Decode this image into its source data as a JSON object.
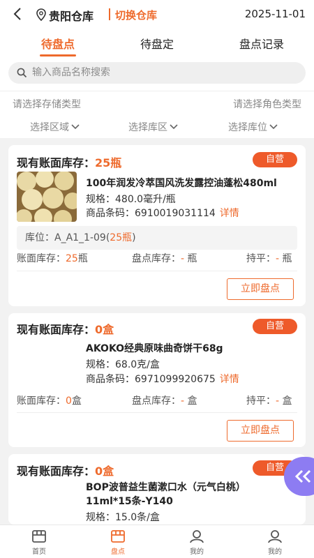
{
  "header": {
    "warehouse": "贵阳仓库",
    "switch_label": "切换仓库",
    "date": "2025-11-01"
  },
  "tabs": [
    {
      "label": "待盘点",
      "active": true
    },
    {
      "label": "待盘定",
      "active": false
    },
    {
      "label": "盘点记录",
      "active": false
    }
  ],
  "search": {
    "placeholder": "输入商品名称搜索"
  },
  "filters": {
    "storage_type": "请选择存储类型",
    "role_type": "请选择角色类型",
    "area": "选择区域",
    "zone": "选择库区",
    "slot": "选择库位"
  },
  "cards": [
    {
      "title_prefix": "现有账面库存：",
      "qty": "25瓶",
      "badge": "自营",
      "name": "100年润发冷萃国风洗发露控油蓬松480ml",
      "spec": "规格：480.0毫升/瓶",
      "code": "商品条码：6910019031114",
      "detail": "详情",
      "location_prefix": "库位：A_A1_1-09(",
      "location_qty": "25瓶",
      "location_suffix": ")",
      "book_label": "账面库存：",
      "book_val": "25",
      "book_unit": "瓶",
      "count_label": "盘点库存：",
      "count_val": "-",
      "count_unit": " 瓶",
      "flat_label": "持平：",
      "flat_val": "-",
      "flat_unit": " 瓶",
      "button": "立即盘点"
    },
    {
      "title_prefix": "现有账面库存：",
      "qty": "0盒",
      "badge": "自营",
      "name": "AKOKO经典原味曲奇饼干68g",
      "spec": "规格：68.0克/盒",
      "code": "商品条码：6971099920675",
      "detail": "详情",
      "book_label": "账面库存：",
      "book_val": "0",
      "book_unit": "盒",
      "count_label": "盘点库存：",
      "count_val": "-",
      "count_unit": " 盒",
      "flat_label": "持平：",
      "flat_val": "-",
      "flat_unit": " 盒",
      "button": "立即盘点"
    },
    {
      "title_prefix": "现有账面库存：",
      "qty": "0盒",
      "badge": "自营",
      "name": "BOP波普益生菌漱口水（元气白桃）11ml*15条-Y140",
      "spec": "规格：15.0条/盒"
    }
  ],
  "bottom_nav": [
    {
      "label": "首页",
      "icon": "home-icon",
      "active": false
    },
    {
      "label": "盘点",
      "icon": "inventory-icon",
      "active": true
    },
    {
      "label": "我的",
      "icon": "user-icon",
      "active": false
    },
    {
      "label": "我的",
      "icon": "user-icon",
      "active": false
    }
  ],
  "colors": {
    "accent": "#ee6a2c",
    "badge": "#ee5a2a",
    "float_button": "#8d7cf2"
  }
}
